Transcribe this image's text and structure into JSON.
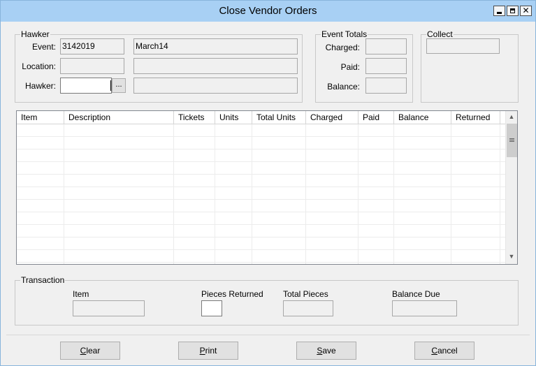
{
  "window": {
    "title": "Close Vendor Orders",
    "controls": {
      "minimize_icon": "minimize-icon",
      "maximize_icon": "maximize-icon",
      "close_symbol": "✕"
    }
  },
  "hawker_group": {
    "legend": "Hawker",
    "event_label": "Event:",
    "event_id": "3142019",
    "event_name": "March14",
    "location_label": "Location:",
    "location_code": "",
    "location_name": "",
    "hawker_label": "Hawker:",
    "hawker_value": "",
    "browse_label": "...",
    "hawker_name": ""
  },
  "event_totals": {
    "legend": "Event Totals",
    "charged_label": "Charged:",
    "charged_value": "",
    "paid_label": "Paid:",
    "paid_value": "",
    "balance_label": "Balance:",
    "balance_value": ""
  },
  "collect": {
    "legend": "Collect",
    "value": ""
  },
  "grid": {
    "columns": [
      "Item",
      "Description",
      "Tickets",
      "Units",
      "Total Units",
      "Charged",
      "Paid",
      "Balance",
      "Returned"
    ],
    "rows": []
  },
  "transaction": {
    "legend": "Transaction",
    "item_label": "Item",
    "item_value": "",
    "pieces_returned_label": "Pieces Returned",
    "pieces_returned_value": "",
    "total_pieces_label": "Total Pieces",
    "total_pieces_value": "",
    "balance_due_label": "Balance Due",
    "balance_due_value": ""
  },
  "buttons": {
    "clear": {
      "mnemonic": "C",
      "rest": "lear"
    },
    "print": {
      "mnemonic": "P",
      "rest": "rint"
    },
    "save": {
      "mnemonic": "S",
      "rest": "ave"
    },
    "cancel": {
      "mnemonic": "C",
      "rest": "ancel"
    }
  }
}
